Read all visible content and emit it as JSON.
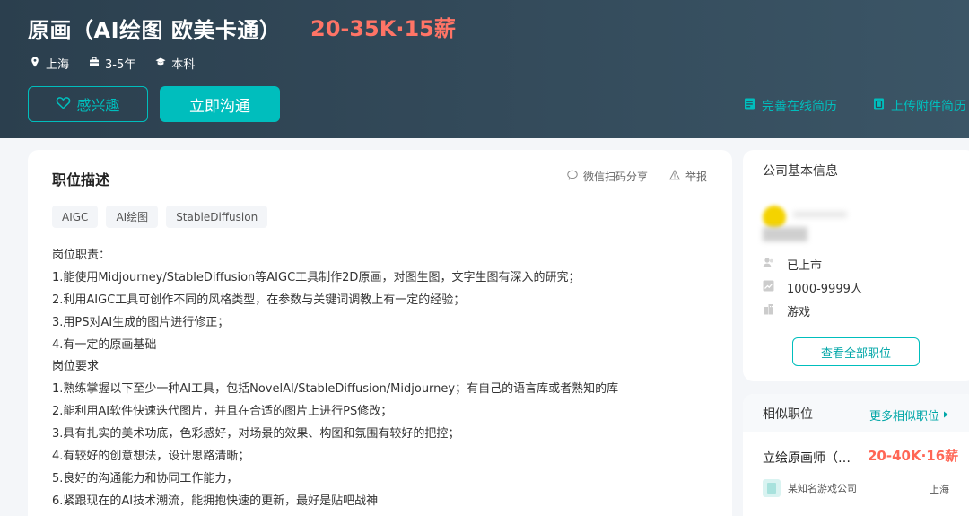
{
  "header": {
    "title": "原画（AI绘图 欧美卡通）",
    "salary": "20-35K·15薪",
    "meta": {
      "city": "上海",
      "experience": "3-5年",
      "degree": "本科"
    },
    "interest_label": "感兴趣",
    "chat_label": "立即沟通",
    "online_resume_label": "完善在线简历",
    "upload_resume_label": "上传附件简历"
  },
  "job": {
    "section_title": "职位描述",
    "share_label": "微信扫码分享",
    "report_label": "举报",
    "tags": [
      "AIGC",
      "AI绘图",
      "StableDiffusion"
    ],
    "description": [
      "岗位职责：",
      "1.能使用Midjourney/StableDiffusion等AIGC工具制作2D原画，对图生图，文字生图有深入的研究；",
      "2.利用AIGC工具可创作不同的风格类型，在参数与关键词调教上有一定的经验；",
      "3.用PS对AI生成的图片进行修正；",
      "4.有一定的原画基础",
      "岗位要求",
      "1.熟练掌握以下至少一种AI工具，包括NovelAI/StableDiffusion/Midjourney；有自己的语言库或者熟知的库",
      "2.能利用AI软件快速迭代图片，并且在合适的图片上进行PS修改；",
      "3.具有扎实的美术功底，色彩感好，对场景的效果、构图和氛围有较好的把控；",
      "4.有较好的创意想法，设计思路清晰；",
      "5.良好的沟通能力和协同工作能力，",
      "6.紧跟现在的AI技术潮流，能拥抱快速的更新，最好是贴吧战神"
    ]
  },
  "company": {
    "section_title": "公司基本信息",
    "stage": "已上市",
    "size": "1000-9999人",
    "industry": "游戏",
    "all_jobs_label": "查看全部职位"
  },
  "similar": {
    "section_title": "相似职位",
    "more_label": "更多相似职位",
    "items": [
      {
        "title": "立绘原画师（…",
        "salary": "20-40K·16薪",
        "company": "某知名游戏公司",
        "city": "上海"
      }
    ]
  },
  "colors": {
    "accent": "#00bebd",
    "salary": "#ff7466",
    "header_bg": "#2b3f4e"
  }
}
